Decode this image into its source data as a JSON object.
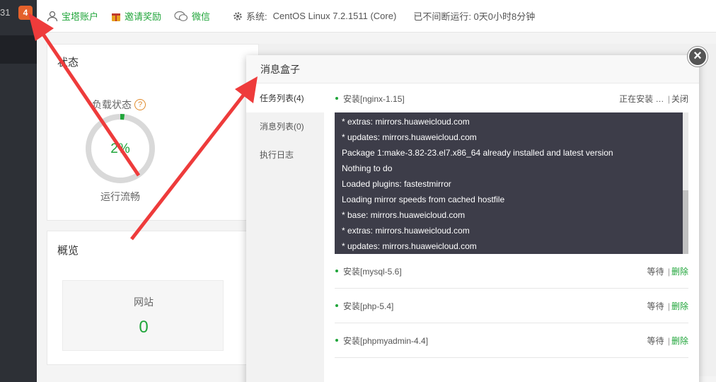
{
  "sidebar": {
    "version_fragment": "31",
    "badge_count": "4"
  },
  "header": {
    "account": "宝塔账户",
    "invite": "邀请奖励",
    "wechat": "微信",
    "system_label": "系统:",
    "system_value": "CentOS Linux 7.2.1511 (Core)",
    "uptime": "已不间断运行: 0天0小时8分钟"
  },
  "status_panel": {
    "title": "状态",
    "load_label": "负载状态",
    "help": "?",
    "load_value": "2%",
    "load_fraction": 0.02,
    "load_state": "运行流畅"
  },
  "overview_panel": {
    "title": "概览",
    "site_label": "网站",
    "site_count": "0"
  },
  "modal": {
    "title": "消息盒子",
    "close": "×",
    "tabs": [
      {
        "label": "任务列表(4)"
      },
      {
        "label": "消息列表(0)"
      },
      {
        "label": "执行日志"
      }
    ],
    "tasks": [
      {
        "name": "安装[nginx-1.15]",
        "status": "正在安装 …",
        "action": "关闭"
      },
      {
        "name": "安装[mysql-5.6]",
        "status": "等待",
        "action": "删除"
      },
      {
        "name": "安装[php-5.4]",
        "status": "等待",
        "action": "删除"
      },
      {
        "name": "安装[phpmyadmin-4.4]",
        "status": "等待",
        "action": "删除"
      }
    ],
    "separator": "|",
    "log_lines": [
      "* extras: mirrors.huaweicloud.com",
      "* updates: mirrors.huaweicloud.com",
      "Package 1:make-3.82-23.el7.x86_64 already installed and latest version",
      "Nothing to do",
      "Loaded plugins: fastestmirror",
      "Loading mirror speeds from cached hostfile",
      "* base: mirrors.huaweicloud.com",
      "* extras: mirrors.huaweicloud.com",
      "* updates: mirrors.huaweicloud.com"
    ]
  },
  "colors": {
    "accent": "#20a53a",
    "badge": "#e4612b",
    "arrow": "#ee3b3b",
    "log_bg": "#3d3d49"
  }
}
